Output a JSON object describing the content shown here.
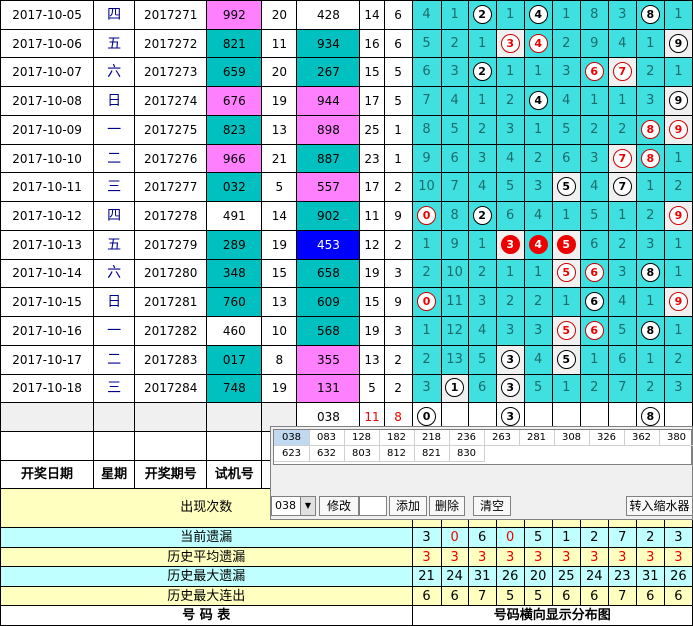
{
  "rows": [
    {
      "date": "2017-10-05",
      "week": "四",
      "issue": "2017271",
      "test": "992",
      "test_bg": "m",
      "n1": "20",
      "draw": "428",
      "draw_bg": "w",
      "sum": "14",
      "span": "6",
      "cells": [
        "4",
        "1",
        "2",
        "1",
        "4",
        "1",
        "8",
        "3",
        "8",
        "1"
      ],
      "marks": [
        "",
        "",
        "w",
        "",
        "w",
        "",
        "",
        "",
        "w",
        ""
      ]
    },
    {
      "date": "2017-10-06",
      "week": "五",
      "issue": "2017272",
      "test": "821",
      "test_bg": "t",
      "n1": "11",
      "draw": "934",
      "draw_bg": "t",
      "sum": "16",
      "span": "6",
      "cells": [
        "5",
        "2",
        "1",
        "3",
        "4",
        "2",
        "9",
        "4",
        "1",
        "9"
      ],
      "marks": [
        "",
        "",
        "",
        "rw",
        "rw",
        "",
        "",
        "",
        "",
        "w"
      ]
    },
    {
      "date": "2017-10-07",
      "week": "六",
      "issue": "2017273",
      "test": "659",
      "test_bg": "t",
      "n1": "20",
      "draw": "267",
      "draw_bg": "t",
      "sum": "15",
      "span": "5",
      "cells": [
        "6",
        "3",
        "2",
        "1",
        "1",
        "3",
        "6",
        "7",
        "2",
        "1"
      ],
      "marks": [
        "",
        "",
        "w",
        "",
        "",
        "",
        "rw",
        "rw",
        "",
        ""
      ]
    },
    {
      "date": "2017-10-08",
      "week": "日",
      "issue": "2017274",
      "test": "676",
      "test_bg": "m",
      "n1": "19",
      "draw": "944",
      "draw_bg": "m",
      "sum": "17",
      "span": "5",
      "cells": [
        "7",
        "4",
        "1",
        "2",
        "4",
        "4",
        "1",
        "1",
        "3",
        "9"
      ],
      "marks": [
        "",
        "",
        "",
        "",
        "w",
        "",
        "",
        "",
        "",
        "w"
      ]
    },
    {
      "date": "2017-10-09",
      "week": "一",
      "issue": "2017275",
      "test": "823",
      "test_bg": "t",
      "n1": "13",
      "draw": "898",
      "draw_bg": "m",
      "sum": "25",
      "span": "1",
      "cells": [
        "8",
        "5",
        "2",
        "3",
        "1",
        "5",
        "2",
        "2",
        "8",
        "9"
      ],
      "marks": [
        "",
        "",
        "",
        "",
        "",
        "",
        "",
        "",
        "rw",
        "rw"
      ]
    },
    {
      "date": "2017-10-10",
      "week": "二",
      "issue": "2017276",
      "test": "966",
      "test_bg": "m",
      "n1": "21",
      "draw": "887",
      "draw_bg": "t",
      "sum": "23",
      "span": "1",
      "cells": [
        "9",
        "6",
        "3",
        "4",
        "2",
        "6",
        "3",
        "7",
        "8",
        "1"
      ],
      "marks": [
        "",
        "",
        "",
        "",
        "",
        "",
        "",
        "rw",
        "rw",
        ""
      ]
    },
    {
      "date": "2017-10-11",
      "week": "三",
      "issue": "2017277",
      "test": "032",
      "test_bg": "t",
      "n1": "5",
      "draw": "557",
      "draw_bg": "m",
      "sum": "17",
      "span": "2",
      "cells": [
        "10",
        "7",
        "4",
        "5",
        "3",
        "5",
        "4",
        "7",
        "1",
        "2"
      ],
      "marks": [
        "",
        "",
        "",
        "",
        "",
        "w",
        "",
        "w",
        "",
        ""
      ]
    },
    {
      "date": "2017-10-12",
      "week": "四",
      "issue": "2017278",
      "test": "491",
      "test_bg": "w",
      "n1": "14",
      "draw": "902",
      "draw_bg": "t",
      "sum": "11",
      "span": "9",
      "cells": [
        "0",
        "8",
        "2",
        "6",
        "4",
        "1",
        "5",
        "1",
        "2",
        "9"
      ],
      "marks": [
        "rw",
        "",
        "w",
        "",
        "",
        "",
        "",
        "",
        "",
        "rw"
      ]
    },
    {
      "date": "2017-10-13",
      "week": "五",
      "issue": "2017279",
      "test": "289",
      "test_bg": "t",
      "n1": "19",
      "draw": "453",
      "draw_bg": "b",
      "sum": "12",
      "span": "2",
      "cells": [
        "1",
        "9",
        "1",
        "3",
        "4",
        "5",
        "6",
        "2",
        "3",
        "1"
      ],
      "marks": [
        "",
        "",
        "",
        "r",
        "r",
        "r",
        "",
        "",
        "",
        ""
      ]
    },
    {
      "date": "2017-10-14",
      "week": "六",
      "issue": "2017280",
      "test": "348",
      "test_bg": "t",
      "n1": "15",
      "draw": "658",
      "draw_bg": "t",
      "sum": "19",
      "span": "3",
      "cells": [
        "2",
        "10",
        "2",
        "1",
        "1",
        "5",
        "6",
        "3",
        "8",
        "1"
      ],
      "marks": [
        "",
        "",
        "",
        "",
        "",
        "rw",
        "rw",
        "",
        "w",
        ""
      ]
    },
    {
      "date": "2017-10-15",
      "week": "日",
      "issue": "2017281",
      "test": "760",
      "test_bg": "t",
      "n1": "13",
      "draw": "609",
      "draw_bg": "t",
      "sum": "15",
      "span": "9",
      "cells": [
        "0",
        "11",
        "3",
        "2",
        "2",
        "1",
        "6",
        "4",
        "1",
        "9"
      ],
      "marks": [
        "rw",
        "",
        "",
        "",
        "",
        "",
        "w",
        "",
        "",
        "rw"
      ]
    },
    {
      "date": "2017-10-16",
      "week": "一",
      "issue": "2017282",
      "test": "460",
      "test_bg": "w",
      "n1": "10",
      "draw": "568",
      "draw_bg": "t",
      "sum": "19",
      "span": "3",
      "cells": [
        "1",
        "12",
        "4",
        "3",
        "3",
        "5",
        "6",
        "5",
        "8",
        "1"
      ],
      "marks": [
        "",
        "",
        "",
        "",
        "",
        "rw",
        "rw",
        "",
        "w",
        ""
      ]
    },
    {
      "date": "2017-10-17",
      "week": "二",
      "issue": "2017283",
      "test": "017",
      "test_bg": "t",
      "n1": "8",
      "draw": "355",
      "draw_bg": "m",
      "sum": "13",
      "span": "2",
      "cells": [
        "2",
        "13",
        "5",
        "3",
        "4",
        "5",
        "1",
        "6",
        "1",
        "2"
      ],
      "marks": [
        "",
        "",
        "",
        "w",
        "",
        "w",
        "",
        "",
        "",
        ""
      ]
    },
    {
      "date": "2017-10-18",
      "week": "三",
      "issue": "2017284",
      "test": "748",
      "test_bg": "t",
      "n1": "19",
      "draw": "131",
      "draw_bg": "m",
      "sum": "5",
      "span": "2",
      "cells": [
        "3",
        "1",
        "6",
        "3",
        "5",
        "1",
        "2",
        "7",
        "2",
        "3"
      ],
      "marks": [
        "",
        "w",
        "",
        "w",
        "",
        "",
        "",
        "",
        "",
        ""
      ]
    }
  ],
  "summary_row": {
    "draw": "038",
    "sum": "11",
    "span": "8",
    "balls": [
      "0",
      "",
      "",
      "3",
      "",
      "",
      "",
      "",
      "8",
      ""
    ]
  },
  "header": {
    "date": "开奖日期",
    "week": "星期",
    "issue": "开奖期号",
    "test": "试机号"
  },
  "stats": [
    {
      "label": "出现次数",
      "values": [
        "",
        "",
        "",
        "",
        "",
        "",
        "",
        "",
        "",
        ""
      ],
      "color": "yel"
    },
    {
      "label": "当前遗漏",
      "values": [
        "3",
        "0",
        "6",
        "0",
        "5",
        "1",
        "2",
        "7",
        "2",
        "3"
      ],
      "color": "cyan"
    },
    {
      "label": "历史平均遗漏",
      "values": [
        "3",
        "3",
        "3",
        "3",
        "3",
        "3",
        "3",
        "3",
        "3",
        "3"
      ],
      "color": "yel"
    },
    {
      "label": "历史最大遗漏",
      "values": [
        "21",
        "24",
        "31",
        "26",
        "20",
        "25",
        "24",
        "23",
        "31",
        "26"
      ],
      "color": "cyan"
    },
    {
      "label": "历史最大连出",
      "values": [
        "6",
        "6",
        "7",
        "5",
        "5",
        "6",
        "6",
        "7",
        "6",
        "6"
      ],
      "color": "yel"
    }
  ],
  "footer": {
    "left": "号 码 表",
    "right": "号码横向显示分布图"
  },
  "panel": {
    "list_row1": [
      "038",
      "083",
      "128",
      "182",
      "218",
      "236",
      "263",
      "281",
      "308",
      "326",
      "362",
      "380"
    ],
    "list_row2": [
      "623",
      "632",
      "803",
      "812",
      "821",
      "830"
    ],
    "select_value": "038",
    "modify_label": "修改",
    "add_label": "添加",
    "delete_label": "删除",
    "clear_label": "清空",
    "transfer_label": "转入缩水器"
  }
}
